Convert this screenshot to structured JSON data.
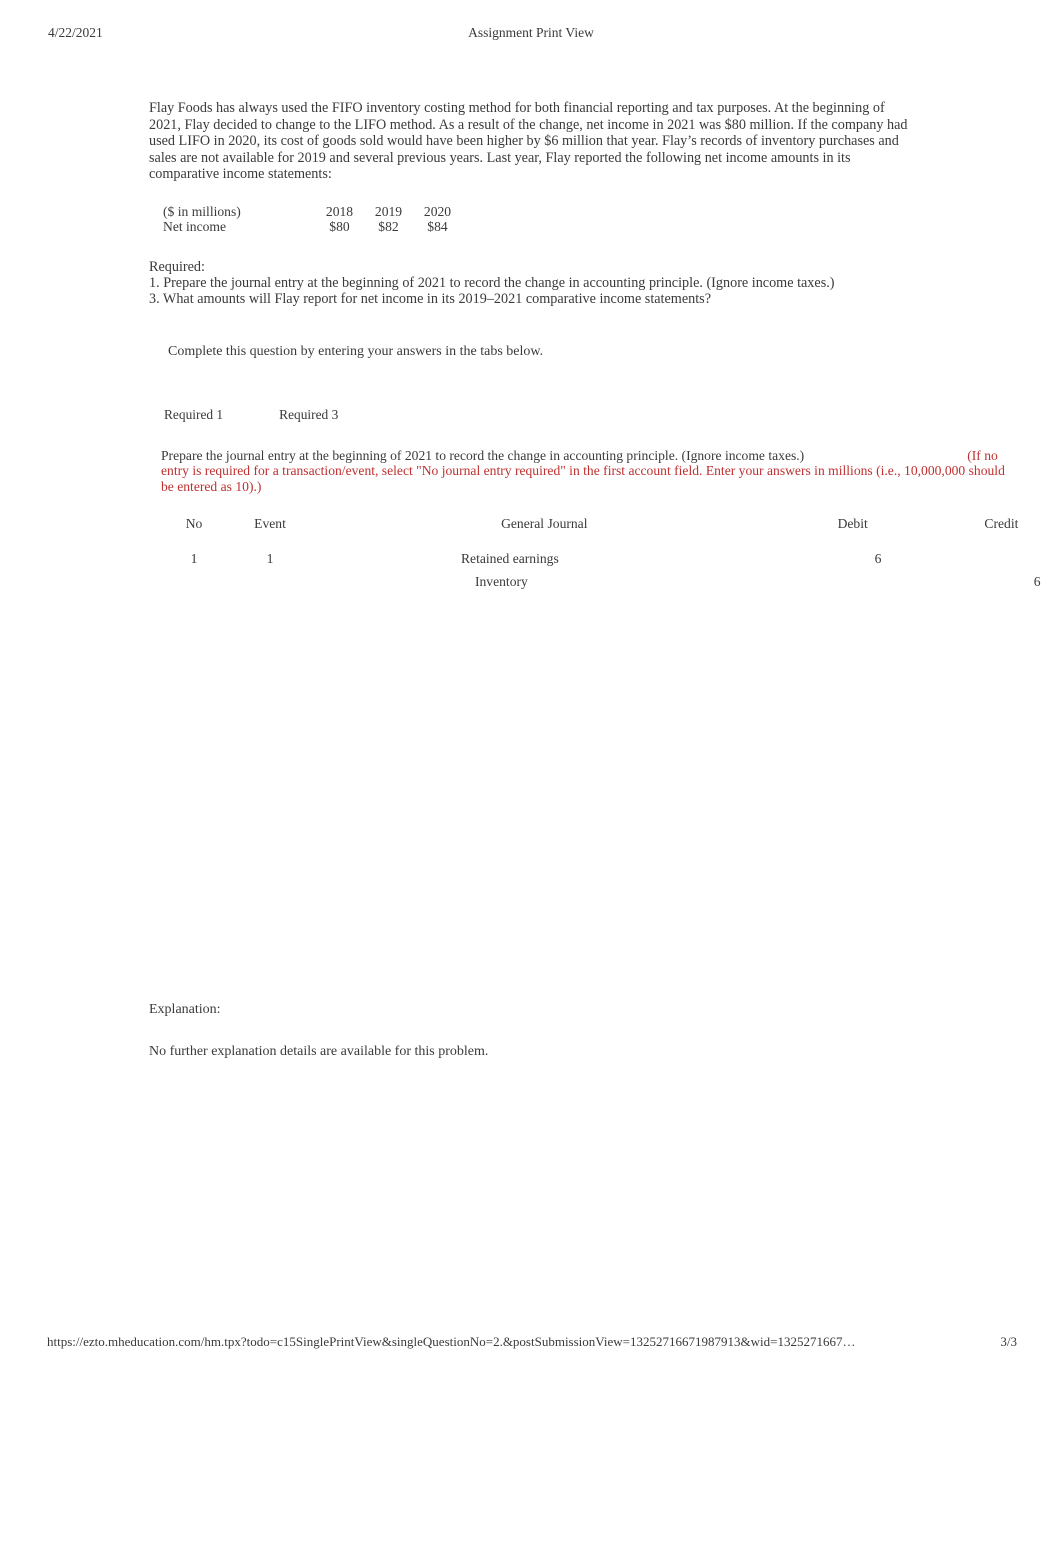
{
  "header": {
    "date": "4/22/2021",
    "title": "Assignment Print View"
  },
  "question": {
    "stem": "Flay Foods has always used the FIFO inventory costing method for both financial reporting and tax purposes. At the beginning of 2021, Flay decided to change to the LIFO method. As a result of the change, net income in 2021 was $80 million. If the company had used LIFO in 2020, its cost of goods sold would have been higher by $6 million that year. Flay’s records of inventory purchases and sales are not available for 2019 and several previous years. Last year, Flay reported the following net income amounts in its comparative income statements:"
  },
  "fact_table": {
    "units_label": "($ in millions)",
    "years": [
      "2018",
      "2019",
      "2020"
    ],
    "row_label": "Net income",
    "values": [
      "$80",
      "$82",
      "$84"
    ]
  },
  "required": {
    "heading": "Required:",
    "items": [
      "1. Prepare the journal entry at the beginning of 2021 to record the change in accounting principle. (Ignore income taxes.)",
      "3. What amounts will Flay report for net income in its 2019–2021 comparative income statements?"
    ]
  },
  "complete_note": "Complete this question by entering your answers in the tabs below.",
  "tabs": [
    {
      "label": "Required 1",
      "selected": true
    },
    {
      "label": "Required 3",
      "selected": false
    }
  ],
  "requirement_prompt": {
    "black_text": "Prepare the journal entry at the beginning of 2021 to record the change in accounting principle. (Ignore income taxes.)",
    "red_text": "(If no entry is required for a transaction/event, select \"No journal entry required\" in the first account field. Enter your answers in millions (i.e., 10,000,000 should be entered as 10).)",
    "red_color": "#bf3030"
  },
  "journal_table": {
    "headers": [
      "No",
      "Event",
      "General Journal",
      "Debit",
      "Credit"
    ],
    "rows": [
      {
        "no": "1",
        "event": "1",
        "account": "Retained earnings",
        "indent": false,
        "debit": "6",
        "credit": ""
      },
      {
        "no": "",
        "event": "",
        "account": "Inventory",
        "indent": true,
        "debit": "",
        "credit": "6"
      }
    ]
  },
  "explanation": {
    "heading": "Explanation:",
    "body": "No further explanation details are available for this problem."
  },
  "footer": {
    "url": "https://ezto.mheducation.com/hm.tpx?todo=c15SinglePrintView&singleQuestionNo=2.&postSubmissionView=13252716671987913&wid=1325271667…",
    "page": "3/3"
  }
}
